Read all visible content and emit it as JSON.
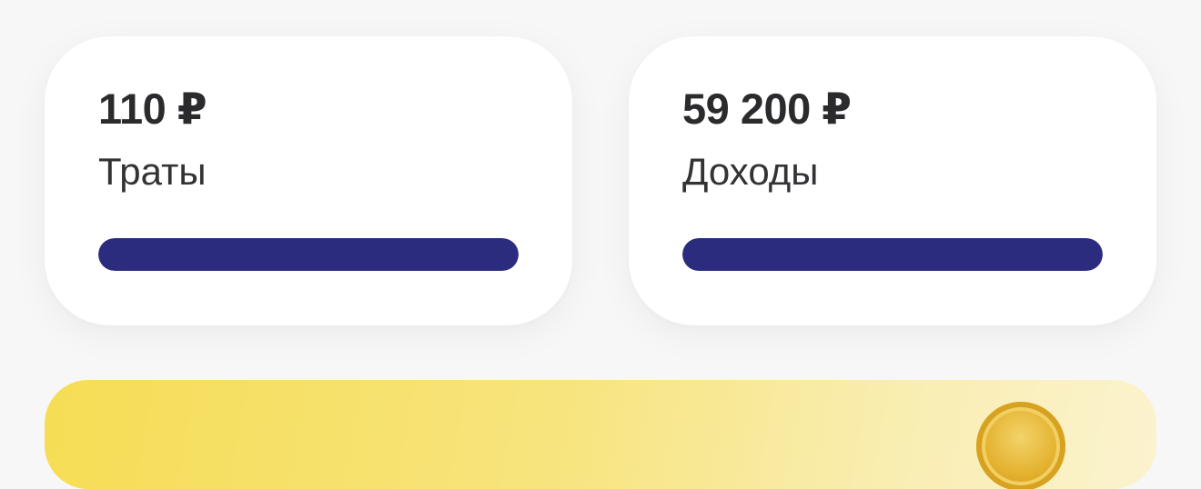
{
  "summary": {
    "expenses": {
      "amount": "110 ₽",
      "label": "Траты",
      "progress": 1.0,
      "bar_color": "#2b2c7e"
    },
    "income": {
      "amount": "59 200 ₽",
      "label": "Доходы",
      "progress": 1.0,
      "bar_color": "#2b2c7e"
    }
  },
  "banner": {
    "icon": "coin-icon",
    "colors": [
      "#f6dd55",
      "#fbf3cf"
    ]
  }
}
